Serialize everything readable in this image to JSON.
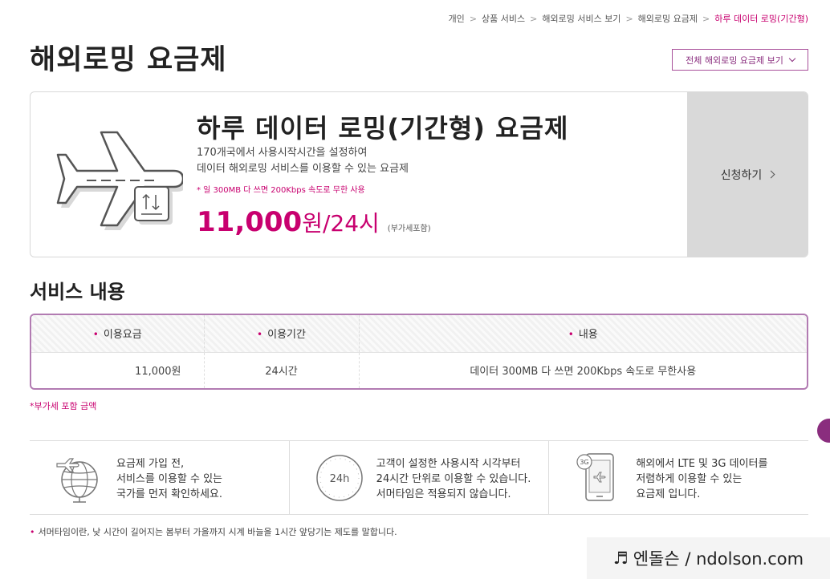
{
  "breadcrumb": {
    "items": [
      "개인",
      "상품 서비스",
      "해외로밍 서비스 보기",
      "해외로밍 요금제"
    ],
    "current": "하루 데이터 로밍(기간형)"
  },
  "page_title": "해외로밍 요금제",
  "all_plans_button": "전체 해외로밍 요금제 보기",
  "product": {
    "name": "하루 데이터 로밍(기간형) 요금제",
    "desc_line1": "170개국에서 사용시작시간을 설정하여",
    "desc_line2": "데이터 해외로밍 서비스를 이용할 수 있는 요금제",
    "note": "* 일 300MB 다 쓰면 200Kbps 속도로 무한 사용",
    "price_amount": "11,000",
    "price_unit": "원",
    "price_period": "/24시",
    "price_vat": "(부가세포함)",
    "apply_button": "신청하기"
  },
  "service_section": {
    "title": "서비스 내용",
    "columns": [
      "이용요금",
      "이용기간",
      "내용"
    ],
    "row": [
      "11,000원",
      "24시간",
      "데이터 300MB 다 쓰면 200Kbps 속도로 무한사용"
    ],
    "vat_note": "*부가세 포함 금액"
  },
  "info": [
    {
      "icon": "globe-plane-icon",
      "lines": [
        "요금제 가입 전,",
        "서비스를 이용할 수 있는",
        "국가를 먼저 확인하세요."
      ]
    },
    {
      "icon": "clock-24h-icon",
      "icon_text": "24h",
      "lines": [
        "고객이 설정한 사용시작 시각부터",
        "24시간 단위로 이용할 수 있습니다.",
        "서머타임은 적용되지 않습니다."
      ]
    },
    {
      "icon": "phone-3g-icon",
      "icon_text": "3G",
      "lines": [
        "해외에서 LTE 및 3G 데이터를",
        "저렴하게 이용할 수 있는",
        "요금제 입니다."
      ]
    }
  ],
  "footnote": "서머타임이란, 낮 시간이 길어지는 봄부터 가을까지 시계 바늘을 1시간 앞당기는 제도를 말합니다.",
  "watermark": {
    "symbol": "♬",
    "text": "엔돌슨 / ndolson.com"
  },
  "colors": {
    "accent": "#c8006f",
    "border_purple": "#b27bb2",
    "button_purple": "#8a2d7e",
    "apply_bg": "#d9d9d9"
  }
}
